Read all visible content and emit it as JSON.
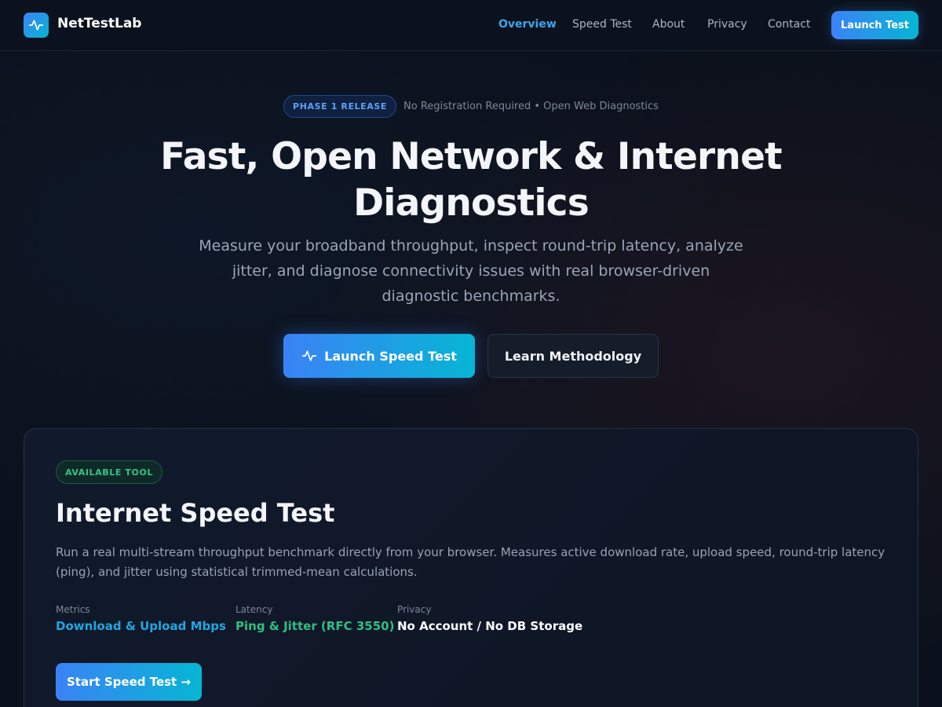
{
  "header": {
    "logo_text": "NetTestLab",
    "logo_icon": "activity-pulse-icon",
    "nav": [
      {
        "label": "Overview",
        "active": true
      },
      {
        "label": "Speed Test",
        "active": false
      },
      {
        "label": "About",
        "active": false
      },
      {
        "label": "Privacy",
        "active": false
      },
      {
        "label": "Contact",
        "active": false
      }
    ],
    "cta_label": "Launch Test"
  },
  "hero": {
    "badge": "PHASE 1 RELEASE",
    "badge_note": "No Registration Required • Open Web Diagnostics",
    "title": "Fast, Open Network & Internet Diagnostics",
    "subtitle": "Measure your broadband throughput, inspect round-trip latency, analyze jitter, and diagnose connectivity issues with real browser-driven diagnostic benchmarks.",
    "primary_button": "Launch Speed Test",
    "primary_button_icon": "activity-pulse-icon",
    "secondary_button": "Learn Methodology"
  },
  "card": {
    "badge": "AVAILABLE TOOL",
    "title": "Internet Speed Test",
    "description": "Run a real multi-stream throughput benchmark directly from your browser. Measures active download rate, upload speed, round-trip latency (ping), and jitter using statistical trimmed-mean calculations.",
    "metrics": [
      {
        "label": "Metrics",
        "value": "Download & Upload Mbps",
        "color": "#22a6e0"
      },
      {
        "label": "Latency",
        "value": "Ping & Jitter (RFC 3550)",
        "color": "#2fbf82"
      },
      {
        "label": "Privacy",
        "value": "No Account / No DB Storage",
        "color": "#ffffff"
      }
    ],
    "button": "Start Speed Test →"
  },
  "colors": {
    "background": "#0b111c",
    "accent_blue": "#3b82f6",
    "accent_cyan": "#06b6d4",
    "accent_green": "#34c48b"
  }
}
